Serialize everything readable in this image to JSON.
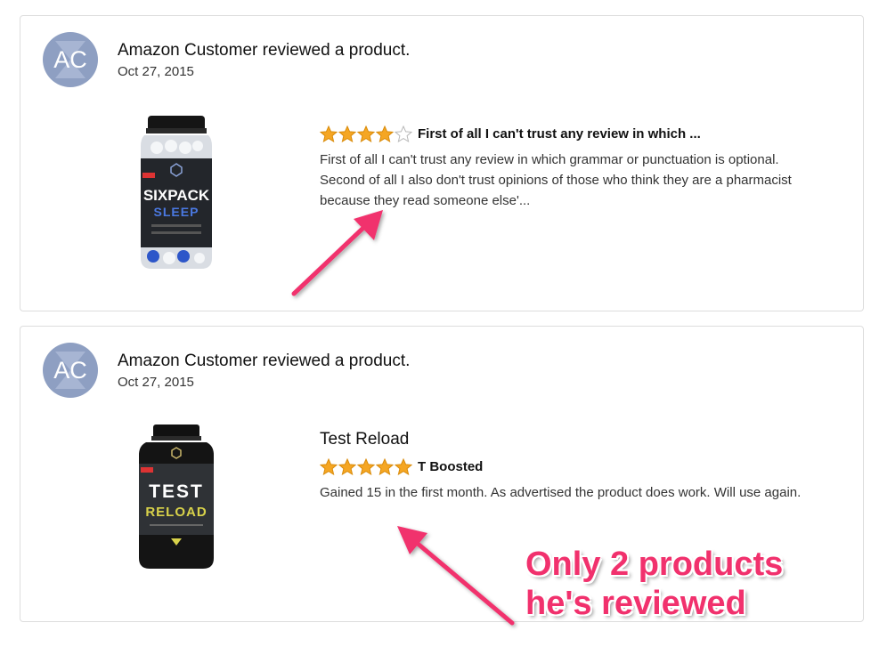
{
  "colors": {
    "annotation": "#f1316d",
    "star_fill": "#f5a623",
    "avatar_bg": "#8e9fc2"
  },
  "reviews": [
    {
      "avatar_initials": "AC",
      "reviewer_line": "Amazon Customer reviewed a product.",
      "date": "Oct 27, 2015",
      "product_label": [
        "SIXPACK",
        "SLEEP"
      ],
      "rating": 4,
      "rating_max": 5,
      "review_title": "First of all I can't trust any review in which ...",
      "review_text": "First of all I can't trust any review in which grammar or punctuation is optional. Second of all I also don't trust opinions of those who think they are a pharmacist because they read someone else'..."
    },
    {
      "avatar_initials": "AC",
      "reviewer_line": "Amazon Customer reviewed a product.",
      "date": "Oct 27, 2015",
      "product_title": "Test Reload",
      "product_label": [
        "TEST",
        "RELOAD"
      ],
      "rating": 5,
      "rating_max": 5,
      "review_title": "T Boosted",
      "review_text": "Gained 15 in the first month. As advertised the product does work. Will use again."
    }
  ],
  "annotation": {
    "line1": "Only 2 products",
    "line2": "he's reviewed"
  }
}
